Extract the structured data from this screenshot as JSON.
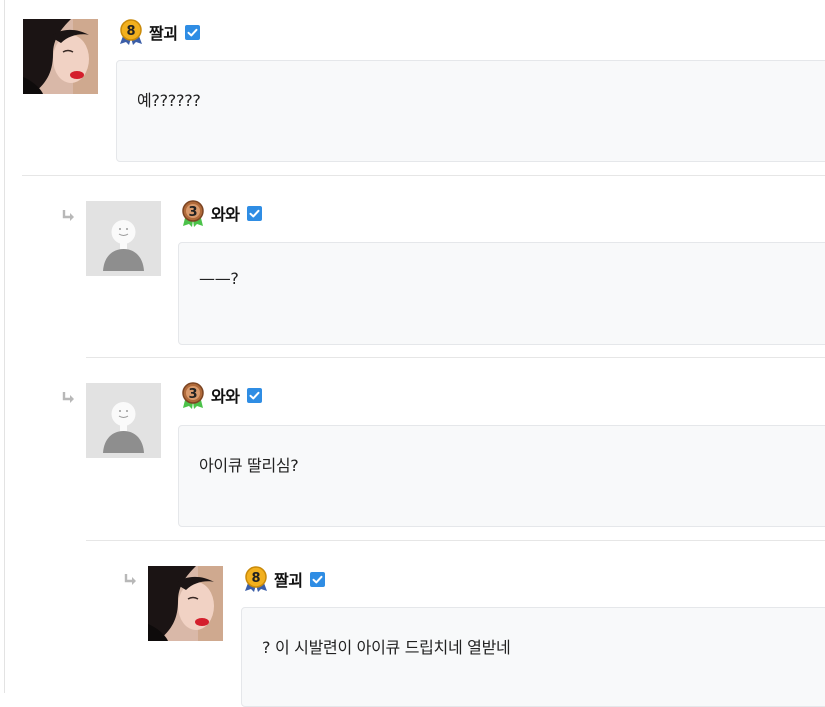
{
  "comments": [
    {
      "id": "c1",
      "nick": "짤괴",
      "level": "8",
      "avatar": "photo-avatar",
      "text": "예??????",
      "reply": false
    },
    {
      "id": "c2",
      "nick": "와와",
      "level": "3",
      "avatar": "default-avatar",
      "text": "——?",
      "reply": true
    },
    {
      "id": "c3",
      "nick": "와와",
      "level": "3",
      "avatar": "default-avatar",
      "text": "아이큐 딸리심?",
      "reply": true
    },
    {
      "id": "c4",
      "nick": "짤괴",
      "level": "8",
      "avatar": "photo-avatar",
      "text": "? 이 시발련이 아이큐 드립치네 열받네",
      "reply": true
    }
  ],
  "icons": {
    "reply": "reply-arrow-icon",
    "verified": "verified-check-icon",
    "level_badge": "level-badge-icon"
  },
  "colors": {
    "verified_blue": "#2f8de4",
    "level8_gold": "#f2b01e",
    "level3_bronze": "#b06a3a",
    "ribbon_blue": "#3b5ea8",
    "ribbon_green": "#4cc24a"
  }
}
